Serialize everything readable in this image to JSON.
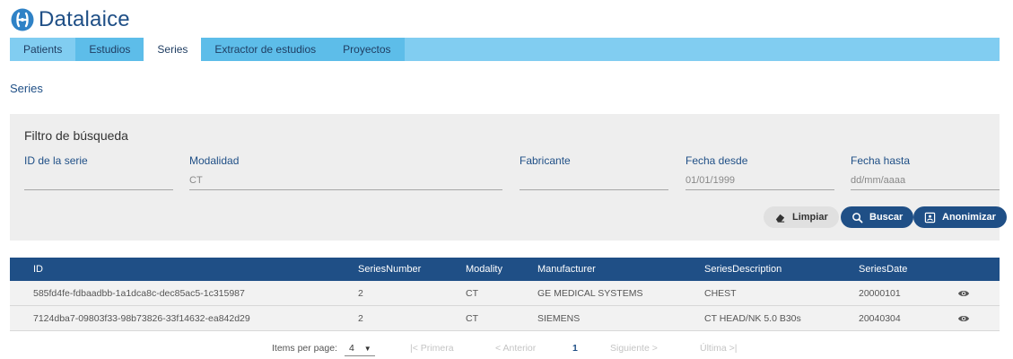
{
  "brand": {
    "name": "Datalaice",
    "color": "#1f4f86"
  },
  "nav": {
    "tabs": [
      {
        "label": "Patients"
      },
      {
        "label": "Estudios"
      },
      {
        "label": "Series"
      },
      {
        "label": "Extractor de estudios"
      },
      {
        "label": "Proyectos"
      }
    ],
    "active": "Series"
  },
  "page": {
    "title": "Series"
  },
  "filter": {
    "title": "Filtro de búsqueda",
    "fields": [
      {
        "label": "ID de la serie",
        "value": ""
      },
      {
        "label": "Modalidad",
        "value": "CT"
      },
      {
        "label": "Fabricante",
        "value": ""
      },
      {
        "label": "Fecha desde",
        "value": "01/01/1999"
      },
      {
        "label": "Fecha hasta",
        "placeholder": "dd/mm/aaaa"
      }
    ],
    "buttons": {
      "clear": "Limpiar",
      "search": "Buscar",
      "anonymize": "Anonimizar"
    }
  },
  "table": {
    "headers": {
      "id": "ID",
      "series_number": "SeriesNumber",
      "modality": "Modality",
      "manufacturer": "Manufacturer",
      "description": "SeriesDescription",
      "date": "SeriesDate"
    },
    "rows": [
      {
        "id": "585fd4fe-fdbaadbb-1a1dca8c-dec85ac5-1c315987",
        "series_number": "2",
        "modality": "CT",
        "manufacturer": "GE MEDICAL SYSTEMS",
        "description": "CHEST",
        "date": "20000101",
        "action_icon": "eye-icon"
      },
      {
        "id": "7124dba7-09803f33-98b73826-33f14632-ea842d29",
        "series_number": "2",
        "modality": "CT",
        "manufacturer": "SIEMENS",
        "description": "CT HEAD/NK 5.0 B30s",
        "date": "20040304",
        "action_icon": "eye-icon"
      }
    ]
  },
  "pagination": {
    "items_per_page_label": "Items per page:",
    "items_per_page": "4",
    "first": "|< Primera",
    "prev": "< Anterior",
    "current": "1",
    "next": "Siguiente >",
    "last": "Última >|"
  },
  "colors": {
    "nav_bg": "#81cdf1",
    "nav_tab_dark": "#5dbde9",
    "primary": "#1f4f86",
    "filter_bg": "#eeeeee"
  }
}
